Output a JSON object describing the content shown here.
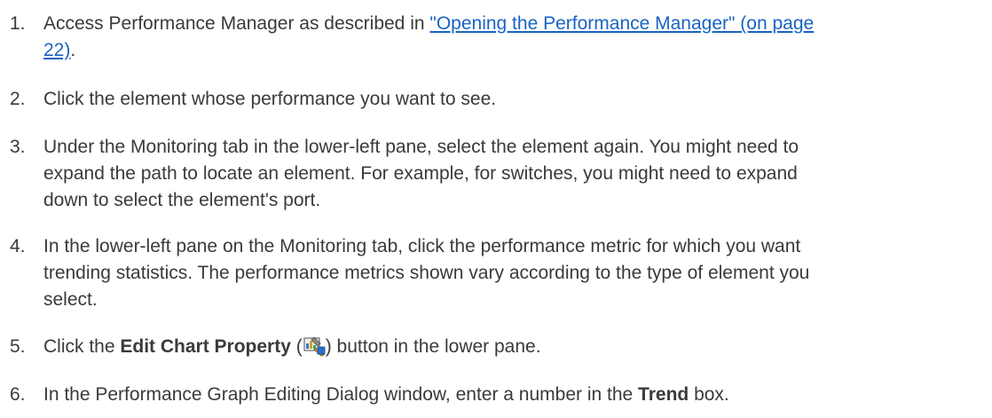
{
  "steps": [
    {
      "number": "1.",
      "text_before": "Access Performance Manager as described in ",
      "link_line1": "\"Opening the Performance Manager\" (on page",
      "link_line2": "22)",
      "text_after": "."
    },
    {
      "number": "2.",
      "text": "Click the element whose performance you want to see."
    },
    {
      "number": "3.",
      "line1": "Under the Monitoring tab in the lower-left pane, select the element again. You might need to",
      "line2": "expand the path to locate an element. For example, for switches, you might need to expand",
      "line3": "down to select the element's port."
    },
    {
      "number": "4.",
      "line1": "In the lower-left pane on the Monitoring tab, click the performance metric for which you want",
      "line2": "trending statistics. The performance metrics shown vary according to the type of element you",
      "line3": "select."
    },
    {
      "number": "5.",
      "text_before": "Click the ",
      "bold": "Edit Chart Property",
      "paren_open": " (",
      "icon": "edit-chart-property-icon",
      "text_after": ") button in the lower pane."
    },
    {
      "number": "6.",
      "text_before": "In the Performance Graph Editing Dialog window, enter a number in the ",
      "bold": "Trend",
      "text_after": " box."
    }
  ]
}
